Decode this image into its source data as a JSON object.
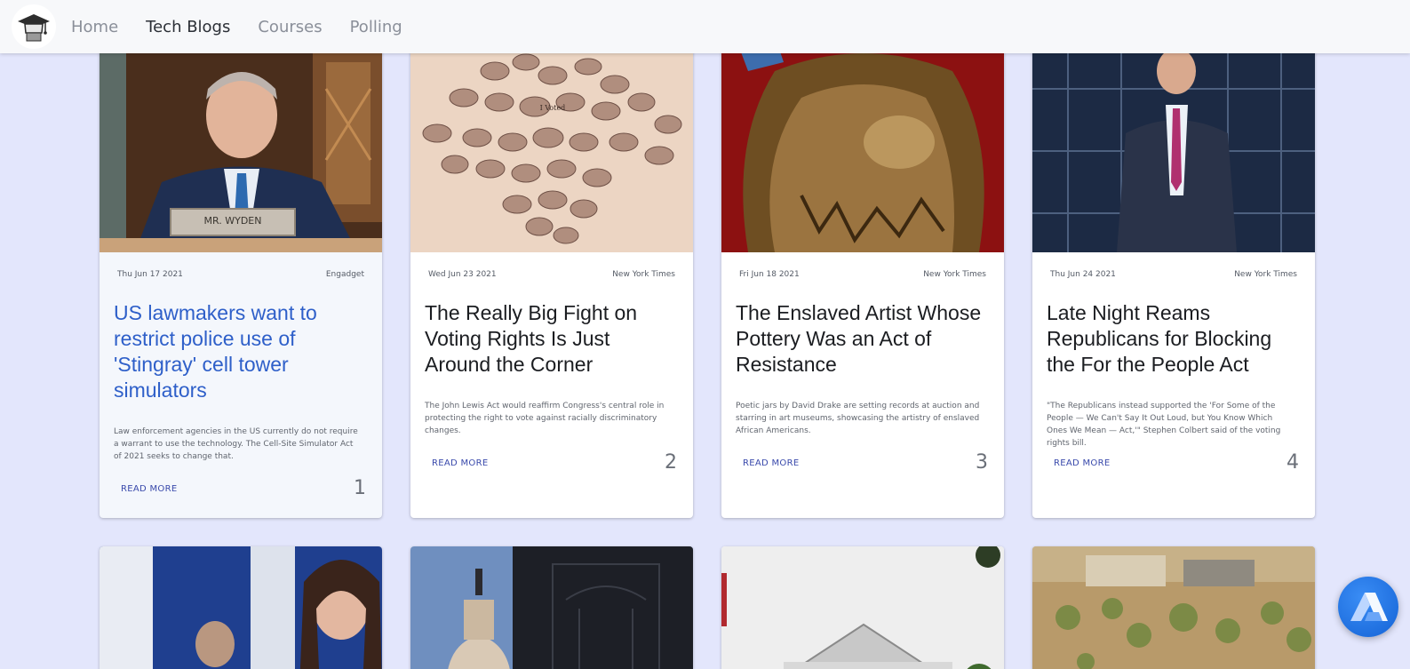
{
  "nav": {
    "items": [
      {
        "label": "Home",
        "active": false
      },
      {
        "label": "Tech Blogs",
        "active": true
      },
      {
        "label": "Courses",
        "active": false
      },
      {
        "label": "Polling",
        "active": false
      }
    ]
  },
  "cards": [
    {
      "date": "Thu Jun 17 2021",
      "source": "Engadget",
      "title": "US lawmakers want to restrict police use of 'Stingray' cell tower simulators",
      "desc": "Law enforcement agencies in the US currently do not require a warrant to use the technology. The Cell-Site Simulator Act of 2021 seeks to change that.",
      "read_more": "READ MORE",
      "number": "1"
    },
    {
      "date": "Wed Jun 23 2021",
      "source": "New York Times",
      "title": "The Really Big Fight on Voting Rights Is Just Around the Corner",
      "desc": "The John Lewis Act would reaffirm Congress's central role in protecting the right to vote against racially discriminatory changes.",
      "read_more": "READ MORE",
      "number": "2"
    },
    {
      "date": "Fri Jun 18 2021",
      "source": "New York Times",
      "title": "The Enslaved Artist Whose Pottery Was an Act of Resistance",
      "desc": "Poetic jars by David Drake are setting records at auction and starring in art museums, showcasing the artistry of enslaved African Americans.",
      "read_more": "READ MORE",
      "number": "3"
    },
    {
      "date": "Thu Jun 24 2021",
      "source": "New York Times",
      "title": "Late Night Reams Republicans for Blocking the For the People Act",
      "desc": "\"The Republicans instead supported the 'For Some of the People — We Can't Say It Out Loud, but You Know Which Ones We Mean — Act,'\" Stephen Colbert said of the voting rights bill.",
      "read_more": "READ MORE",
      "number": "4"
    }
  ],
  "plaque_text": "MR. WYDEN",
  "sticker_text": "I Voted",
  "colors": {
    "page_bg": "#e3e6fc",
    "accent": "#3949ab",
    "active_title": "#2e5fc9",
    "fab": "#1f6fe0"
  }
}
